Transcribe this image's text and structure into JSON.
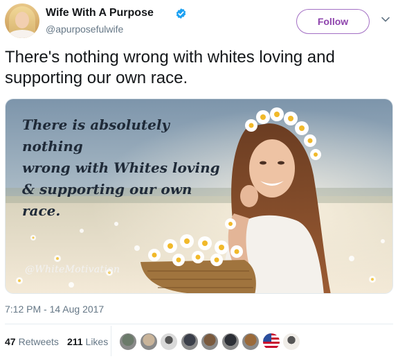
{
  "tweet": {
    "author_name": "Wife With A Purpose",
    "author_handle": "@apurposefulwife",
    "follow_label": "Follow",
    "text": "There's nothing wrong with whites loving and supporting our own race.",
    "timestamp": "7:12 PM - 14 Aug 2017"
  },
  "media": {
    "quote_text": "There is absolutely nothing\nwrong with Whites loving\n& supporting our own race.",
    "watermark": "@WhiteMotivation"
  },
  "stats": {
    "retweets_count": "47",
    "retweets_label": "Retweets",
    "likes_count": "211",
    "likes_label": "Likes"
  },
  "likers": [
    {
      "name": "liker-avatar-1",
      "color": "#6b7a6a"
    },
    {
      "name": "liker-avatar-2",
      "color": "#c9b49a"
    },
    {
      "name": "liker-avatar-3",
      "color": "#d9d9d9"
    },
    {
      "name": "liker-avatar-4",
      "color": "#3b3f4a"
    },
    {
      "name": "liker-avatar-5",
      "color": "#7a5a3e"
    },
    {
      "name": "liker-avatar-6",
      "color": "#2c2f36"
    },
    {
      "name": "liker-avatar-7",
      "color": "#9a6a3a"
    },
    {
      "name": "liker-avatar-8",
      "color": "#2a4f9e"
    },
    {
      "name": "liker-avatar-9",
      "color": "#f0ede8"
    }
  ],
  "colors": {
    "verified_blue": "#1da1f2",
    "follow_purple": "#8e44ad",
    "muted_text": "#657786"
  }
}
